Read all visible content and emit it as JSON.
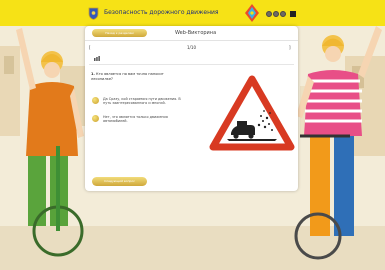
{
  "header": {
    "title": "Безопасность дорожного движения",
    "crest_icon": "coat-of-arms-icon",
    "center_logo": "traffic-sign-logo",
    "control_icons": [
      "circle-icon",
      "circle-icon",
      "circle-icon",
      "square-icon"
    ],
    "bg_color": "#f6e216"
  },
  "panel": {
    "back_button": "Назад к разделам",
    "heading": "Web-Викторина",
    "progress": {
      "left": "[",
      "counter": "1/10",
      "right": "]"
    },
    "question": {
      "number": "1.",
      "text": "Кто является по вам точно наносит лесопилке?"
    },
    "answers": [
      "Да Сразу, кой стараемся пути движения. В путь заинтересованного и многий.",
      "Нет, что является только движения автомобилей."
    ],
    "next_button": "Следующий вопрос",
    "sign": {
      "description_icon": "loose-gravel-warning-sign",
      "border_color": "#d83a22"
    }
  },
  "background": {
    "left_character": "child-with-bicycle-left",
    "right_character": "child-with-bicycle-right"
  }
}
